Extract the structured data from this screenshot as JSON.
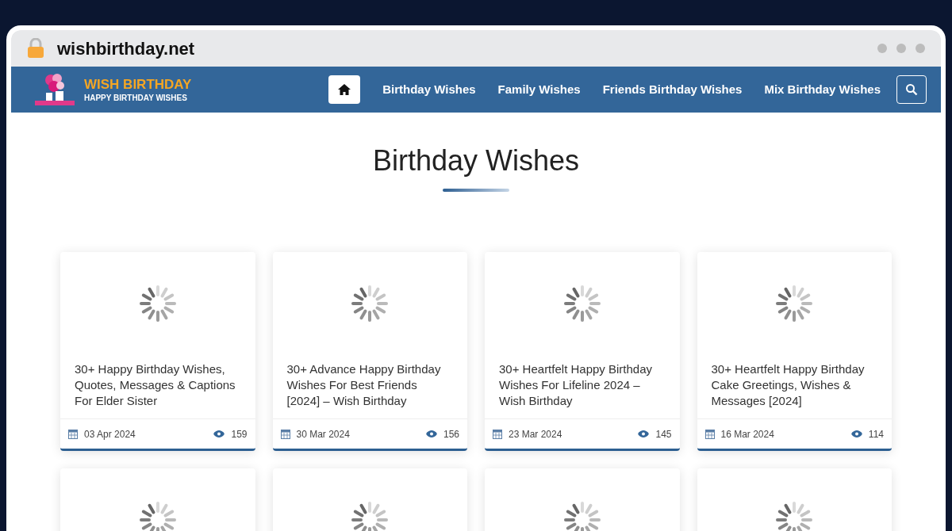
{
  "browser": {
    "address": "wishbirthday.net"
  },
  "header": {
    "logo_title": "WISH BIRTHDAY",
    "logo_tagline": "HAPPY BIRTHDAY WISHES",
    "nav": [
      {
        "kind": "home",
        "selected": true
      },
      {
        "kind": "link",
        "label": "Birthday Wishes",
        "selected": false
      },
      {
        "kind": "link",
        "label": "Family Wishes",
        "selected": false
      },
      {
        "kind": "link",
        "label": "Friends Birthday Wishes",
        "selected": false
      },
      {
        "kind": "link",
        "label": "Mix Birthday Wishes",
        "selected": false
      }
    ]
  },
  "page_title": "Birthday Wishes",
  "posts": [
    {
      "title": "30+ Happy Birthday Wishes, Quotes, Messages & Captions For Elder Sister",
      "date": "03 Apr 2024",
      "views": "159"
    },
    {
      "title": "30+ Advance Happy Birthday Wishes For Best Friends [2024] – Wish Birthday",
      "date": "30 Mar 2024",
      "views": "156"
    },
    {
      "title": "30+ Heartfelt Happy Birthday Wishes For Lifeline 2024 – Wish Birthday",
      "date": "23 Mar 2024",
      "views": "145"
    },
    {
      "title": "30+ Heartfelt Happy Birthday Cake Greetings, Wishes & Messages [2024]",
      "date": "16 Mar 2024",
      "views": "114"
    }
  ],
  "loading_cards": [
    {
      "kind": "spinner"
    },
    {
      "kind": "spinner"
    },
    {
      "kind": "spinner"
    },
    {
      "kind": "spinner"
    }
  ]
}
